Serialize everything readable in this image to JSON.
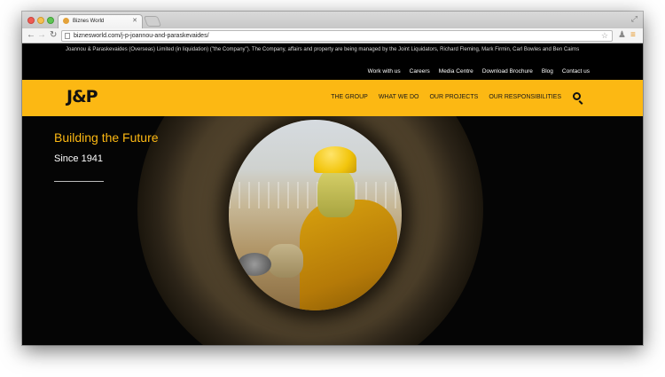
{
  "browser": {
    "tab_title": "Biznes World",
    "url": "biznesworld.com/j-p-joannou-and-paraskevaides/"
  },
  "site": {
    "notice": "Joannou & Paraskevaides (Overseas) Limited (in liquidation) (\"the Company\"). The Company, affairs and property are being managed by the Joint Liquidators, Richard Fleming, Mark Firmin, Carl Bowles and Ben Cairns",
    "top_links": [
      "Work with us",
      "Careers",
      "Media Centre",
      "Download Brochure",
      "Blog",
      "Contact us"
    ],
    "logo": "J&P",
    "nav": [
      "THE GROUP",
      "WHAT WE DO",
      "OUR PROJECTS",
      "OUR RESPONSIBILITIES"
    ],
    "brand_color": "#fcb813"
  },
  "hero": {
    "title": "Building the Future",
    "subtitle": "Since 1941"
  }
}
